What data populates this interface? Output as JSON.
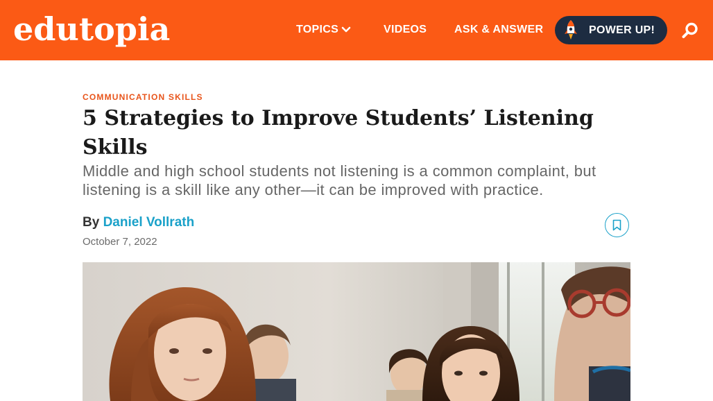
{
  "header": {
    "logo_text": "edutopia",
    "brand_color": "#fb5a15",
    "nav": {
      "topics": "TOPICS",
      "videos": "VIDEOS",
      "ask_answer": "ASK & ANSWER"
    },
    "power_button": "POWER UP!",
    "icons": [
      "chevron-down-icon",
      "rocket-icon",
      "search-icon"
    ]
  },
  "article": {
    "category": "COMMUNICATION SKILLS",
    "title": "5 Strategies to Improve Students’ Listening Skills",
    "subtitle": "Middle and high school students not listening is a common complaint, but listening is a skill like any other—it can be improved with practice.",
    "byline_prefix": "By",
    "author": "Daniel Vollrath",
    "date": "October 7, 2022",
    "bookmark_icon": "bookmark-icon",
    "accent_color": "#1aa1c9"
  }
}
